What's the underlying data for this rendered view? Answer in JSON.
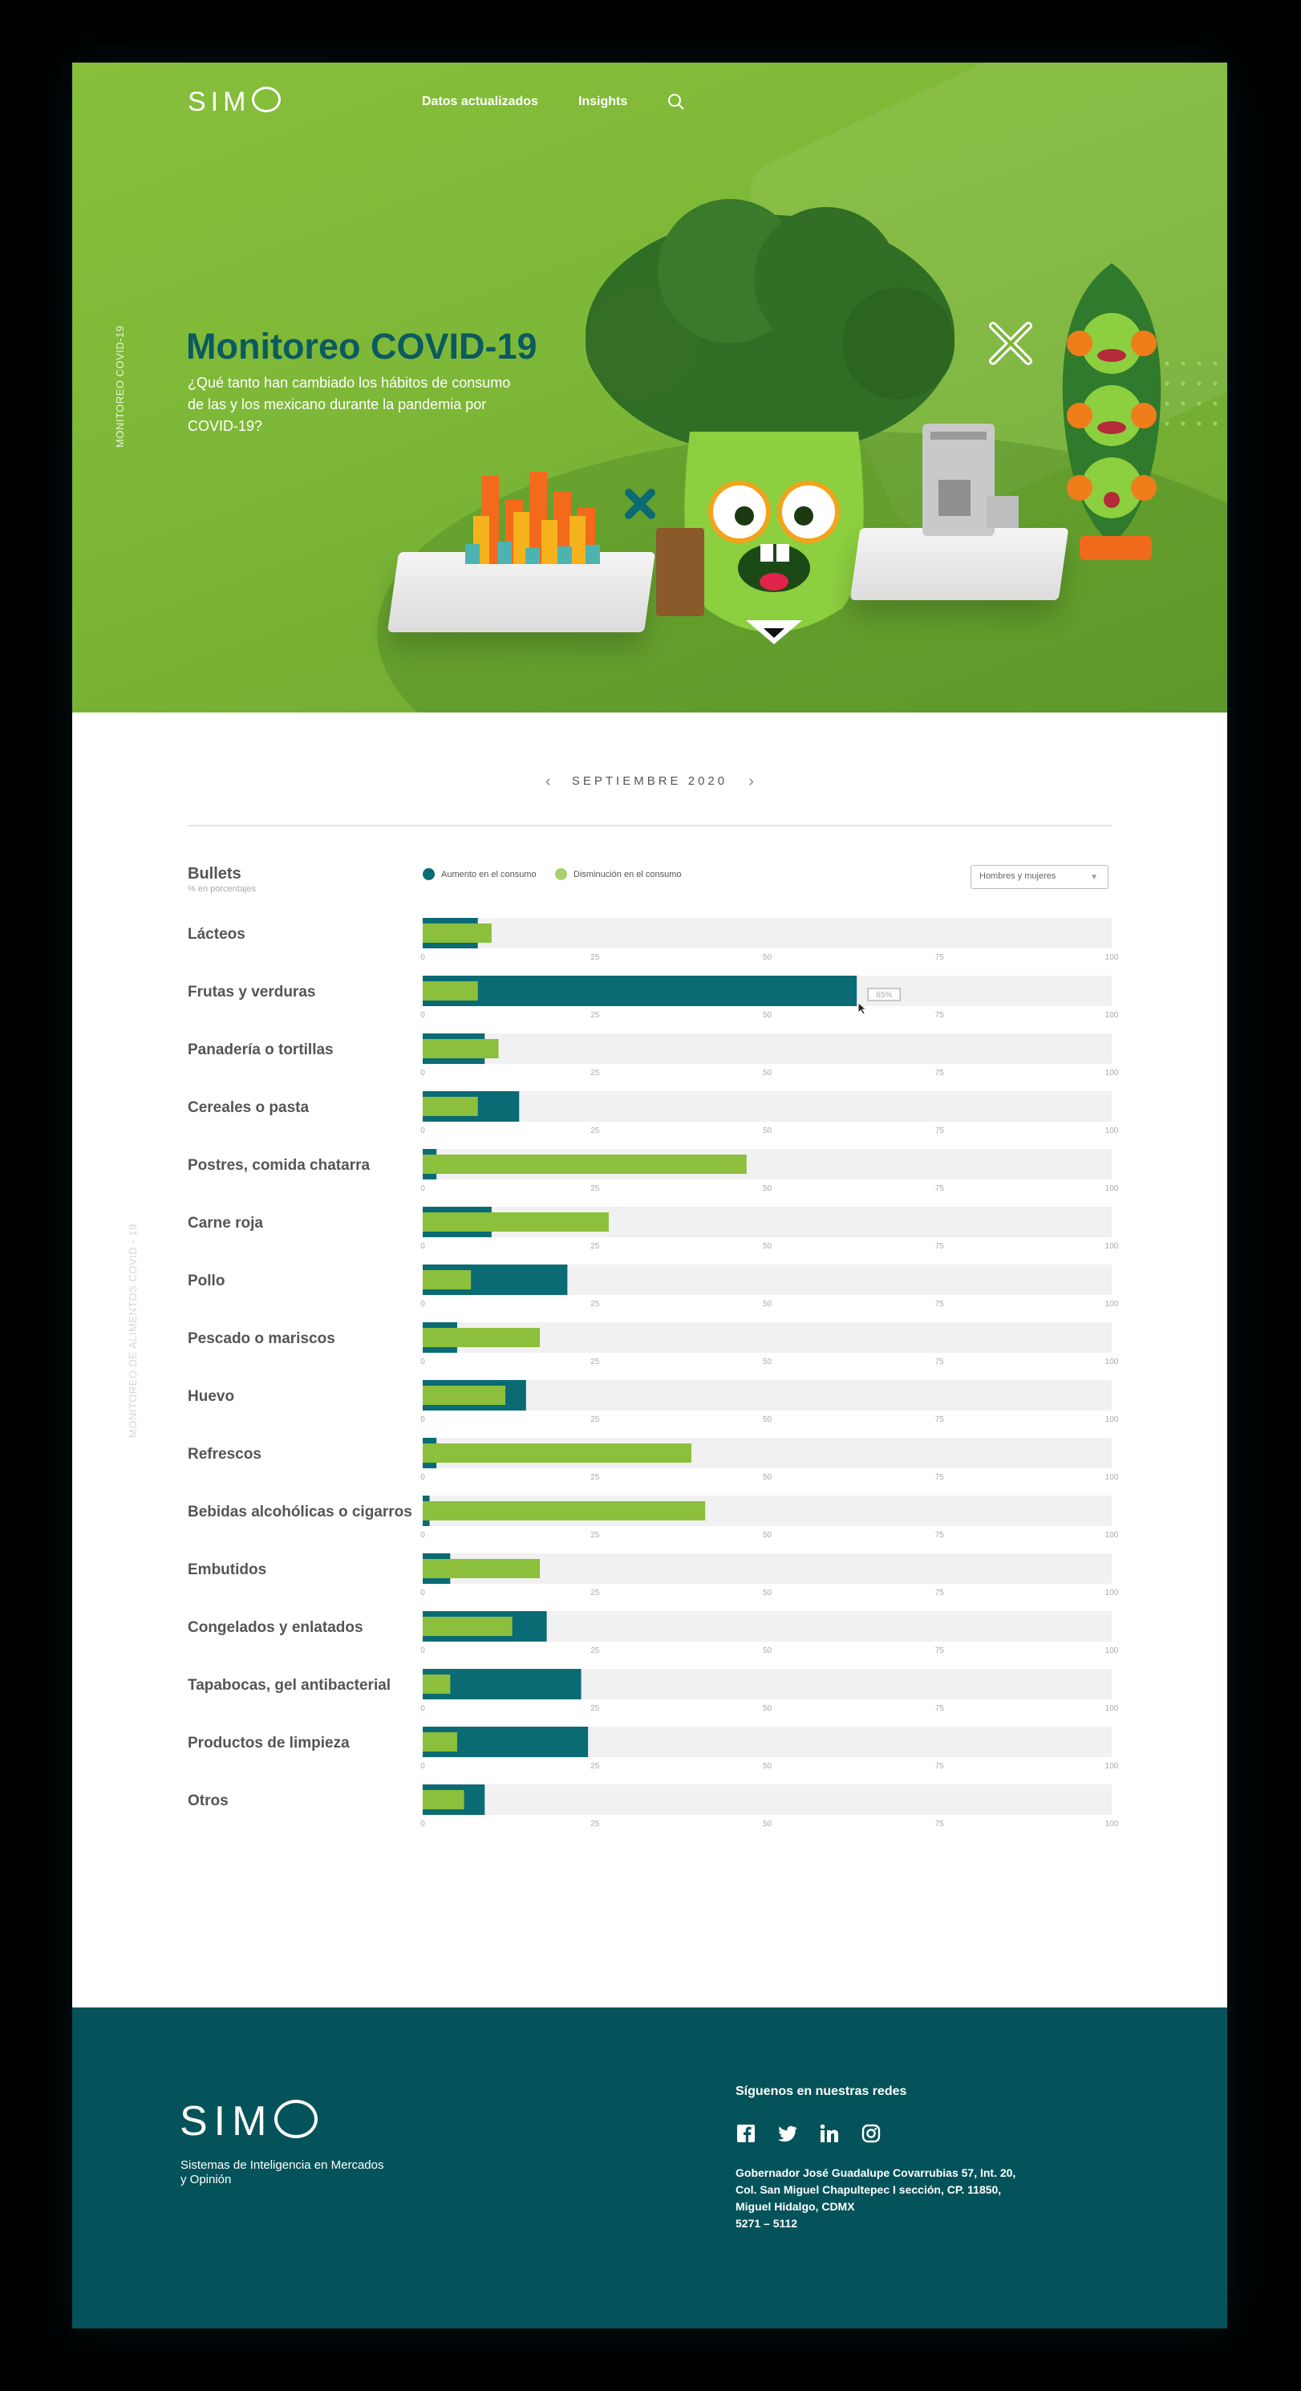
{
  "header": {
    "logo": "SIM",
    "nav": [
      {
        "label": "Datos actualizados"
      },
      {
        "label": "Insights"
      }
    ],
    "search_icon": "search-icon"
  },
  "hero": {
    "side_label": "MONITOREO COVID-19",
    "title": "Monitoreo COVID-19",
    "subtitle": "¿Qué tanto han cambiado los hábitos de consumo de las y los mexicano durante la pandemia por COVID-19?"
  },
  "month_selector": {
    "label": "SEPTIEMBRE 2020",
    "prev": "‹",
    "next": "›"
  },
  "chart_header": {
    "title": "Bullets",
    "subtitle": "% en porcentajes",
    "legend": [
      {
        "label": "Aumento en el consumo",
        "color": "#0b6b74"
      },
      {
        "label": "Disminución en el consumo",
        "color": "#8bbf3c"
      }
    ],
    "filter": {
      "selected": "Hombres y mujeres"
    }
  },
  "chart_data": {
    "type": "bar",
    "orientation": "horizontal",
    "xlim": [
      0,
      100
    ],
    "ticks": [
      0,
      25,
      50,
      75,
      100
    ],
    "categories": [
      "Lácteos",
      "Frutas y verduras",
      "Panadería o tortillas",
      "Cereales o pasta",
      "Postres, comida chatarra",
      "Carne roja",
      "Pollo",
      "Pescado o mariscos",
      "Huevo",
      "Refrescos",
      "Bebidas alcohólicas o cigarros",
      "Embutidos",
      "Congelados y  enlatados",
      "Tapabocas, gel antibacterial",
      "Productos de limpieza",
      "Otros"
    ],
    "series": [
      {
        "name": "Aumento en el consumo",
        "color": "#0b6b74",
        "values": [
          8,
          63,
          9,
          14,
          2,
          10,
          21,
          5,
          15,
          2,
          1,
          4,
          18,
          23,
          24,
          9
        ]
      },
      {
        "name": "Disminución en el consumo",
        "color": "#8bbf3c",
        "values": [
          10,
          8,
          11,
          8,
          47,
          27,
          7,
          17,
          12,
          39,
          41,
          17,
          13,
          4,
          5,
          6
        ]
      }
    ],
    "tooltip": {
      "category": "Frutas y verduras",
      "text": "65%"
    },
    "track_color": "#f1f1f1"
  },
  "side_label_2": "MONITOREO DE ALIMENTOS COVID - 19",
  "footer": {
    "logo": "SIM",
    "tagline": "Sistemas de Inteligencia en Mercados y Opinión",
    "social_title": "Síguenos en nuestras redes",
    "social_icons": [
      "facebook-icon",
      "twitter-icon",
      "linkedin-icon",
      "instagram-icon"
    ],
    "address_lines": [
      "Gobernador José Guadalupe Covarrubias 57, Int. 20,",
      "Col. San Miguel Chapultepec I sección, CP. 11850,",
      "Miguel Hidalgo, CDMX",
      "5271 – 5112"
    ]
  }
}
